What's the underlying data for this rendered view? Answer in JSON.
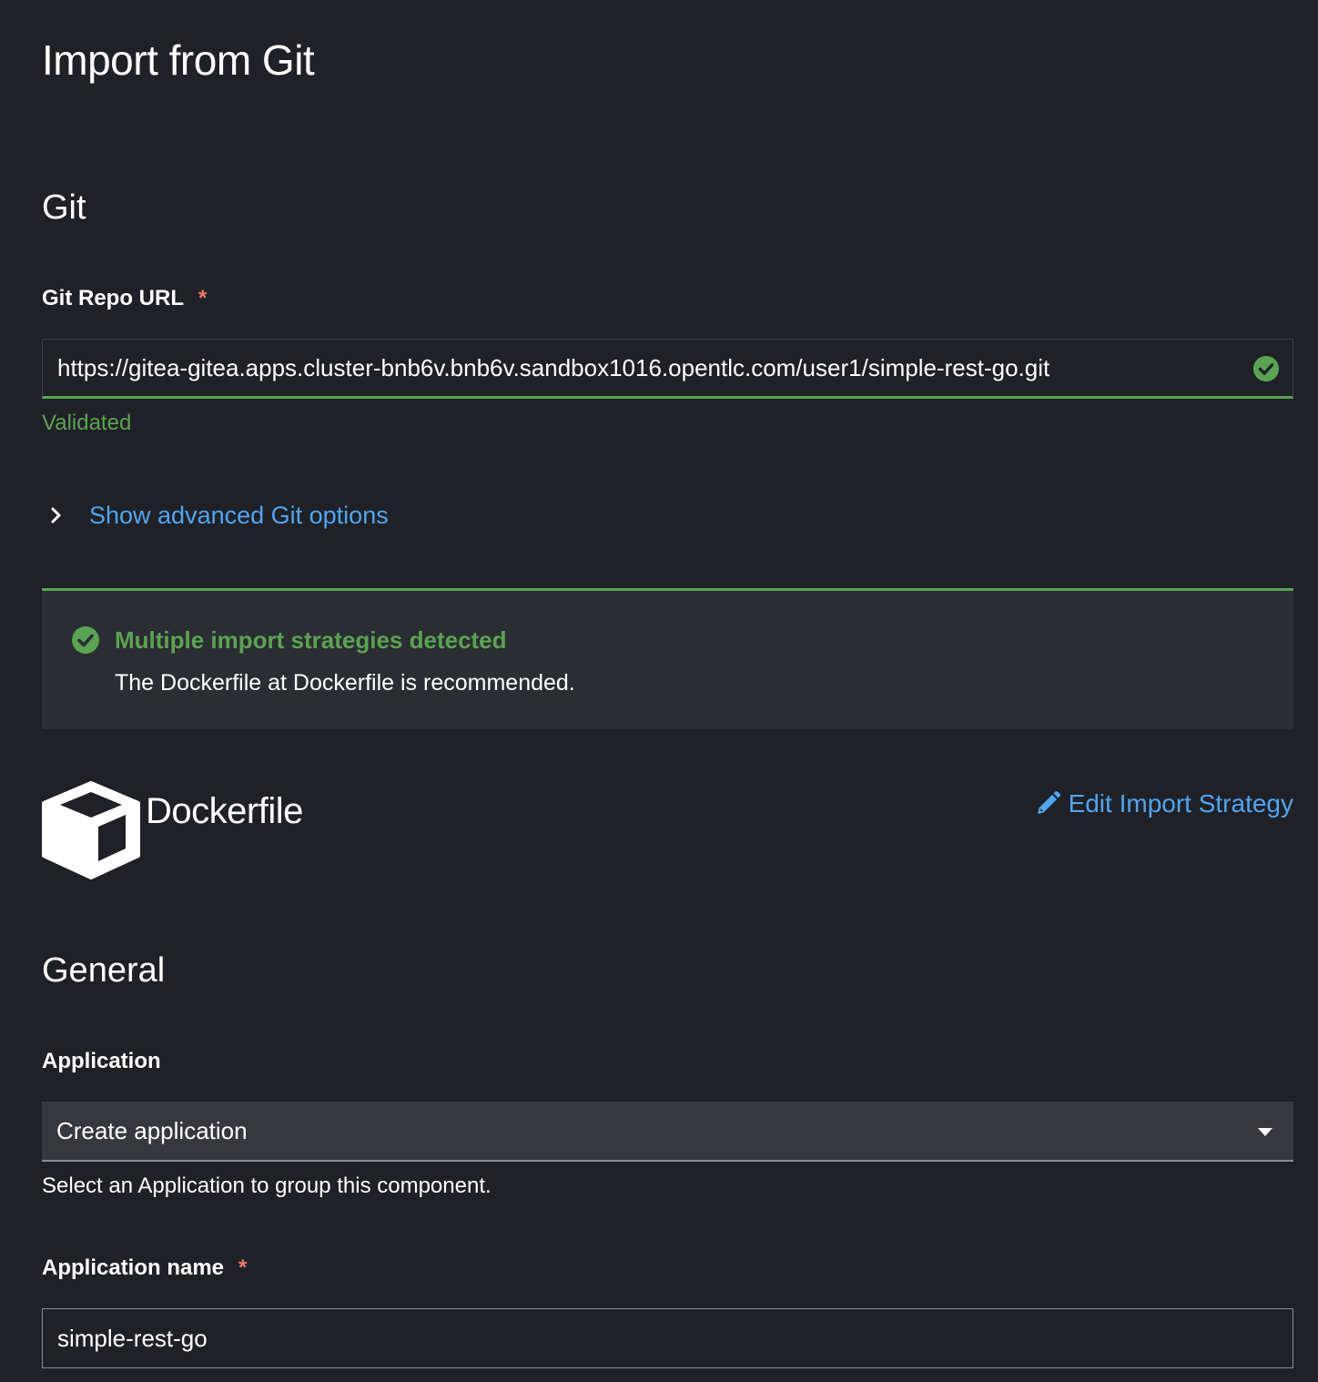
{
  "page": {
    "title": "Import from Git"
  },
  "git": {
    "section_title": "Git",
    "repo_url": {
      "label": "Git Repo URL",
      "required_marker": "*",
      "value": "https://gitea-gitea.apps.cluster-bnb6v.bnb6v.sandbox1016.opentlc.com/user1/simple-rest-go.git",
      "status_icon": "check-circle-icon",
      "helper": "Validated"
    },
    "advanced_toggle": {
      "icon": "chevron-right-icon",
      "label": "Show advanced Git options"
    }
  },
  "alert": {
    "icon": "check-circle-icon",
    "title": "Multiple import strategies detected",
    "description": "The Dockerfile at Dockerfile is recommended."
  },
  "strategy": {
    "icon": "dockerfile-cube-icon",
    "name": "Dockerfile",
    "edit_icon": "pencil-icon",
    "edit_label": "Edit Import Strategy"
  },
  "general": {
    "section_title": "General",
    "application": {
      "label": "Application",
      "selected": "Create application",
      "helper": "Select an Application to group this component."
    },
    "application_name": {
      "label": "Application name",
      "required_marker": "*",
      "value": "simple-rest-go"
    }
  },
  "colors": {
    "background": "#1f2126",
    "success": "#5ba352",
    "link": "#4fa6f2",
    "required": "#f0786a",
    "alert_bg": "#2a2d32",
    "select_bg": "#36383e"
  }
}
